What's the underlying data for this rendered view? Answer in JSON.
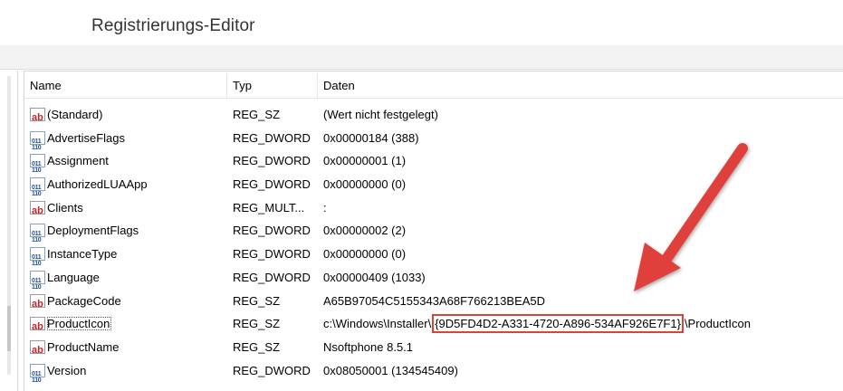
{
  "window": {
    "title": "Registrierungs-Editor"
  },
  "columns": {
    "name": "Name",
    "type": "Typ",
    "data": "Daten"
  },
  "rows": [
    {
      "icon": "reg-sz-icon",
      "name": "(Standard)",
      "type": "REG_SZ",
      "data": "(Wert nicht festgelegt)"
    },
    {
      "icon": "reg-dword-icon",
      "name": "AdvertiseFlags",
      "type": "REG_DWORD",
      "data": "0x00000184 (388)"
    },
    {
      "icon": "reg-dword-icon",
      "name": "Assignment",
      "type": "REG_DWORD",
      "data": "0x00000001 (1)"
    },
    {
      "icon": "reg-dword-icon",
      "name": "AuthorizedLUAApp",
      "type": "REG_DWORD",
      "data": "0x00000000 (0)"
    },
    {
      "icon": "reg-sz-icon",
      "name": "Clients",
      "type": "REG_MULT...",
      "data": ":"
    },
    {
      "icon": "reg-dword-icon",
      "name": "DeploymentFlags",
      "type": "REG_DWORD",
      "data": "0x00000002 (2)"
    },
    {
      "icon": "reg-dword-icon",
      "name": "InstanceType",
      "type": "REG_DWORD",
      "data": "0x00000000 (0)"
    },
    {
      "icon": "reg-dword-icon",
      "name": "Language",
      "type": "REG_DWORD",
      "data": "0x00000409 (1033)"
    },
    {
      "icon": "reg-sz-icon",
      "name": "PackageCode",
      "type": "REG_SZ",
      "data": "A65B97054C5155343A68F766213BEA5D"
    },
    {
      "icon": "reg-sz-icon",
      "name": "ProductIcon",
      "type": "REG_SZ",
      "data_prefix": "c:\\Windows\\Installer\\",
      "data_highlight": "{9D5FD4D2-A331-4720-A896-534AF926E7F1}",
      "data_suffix": "\\ProductIcon"
    },
    {
      "icon": "reg-sz-icon",
      "name": "ProductName",
      "type": "REG_SZ",
      "data": "Nsoftphone 8.5.1"
    },
    {
      "icon": "reg-dword-icon",
      "name": "Version",
      "type": "REG_DWORD",
      "data": "0x08050001 (134545409)"
    }
  ],
  "colors": {
    "annotation": "#e0403a"
  }
}
